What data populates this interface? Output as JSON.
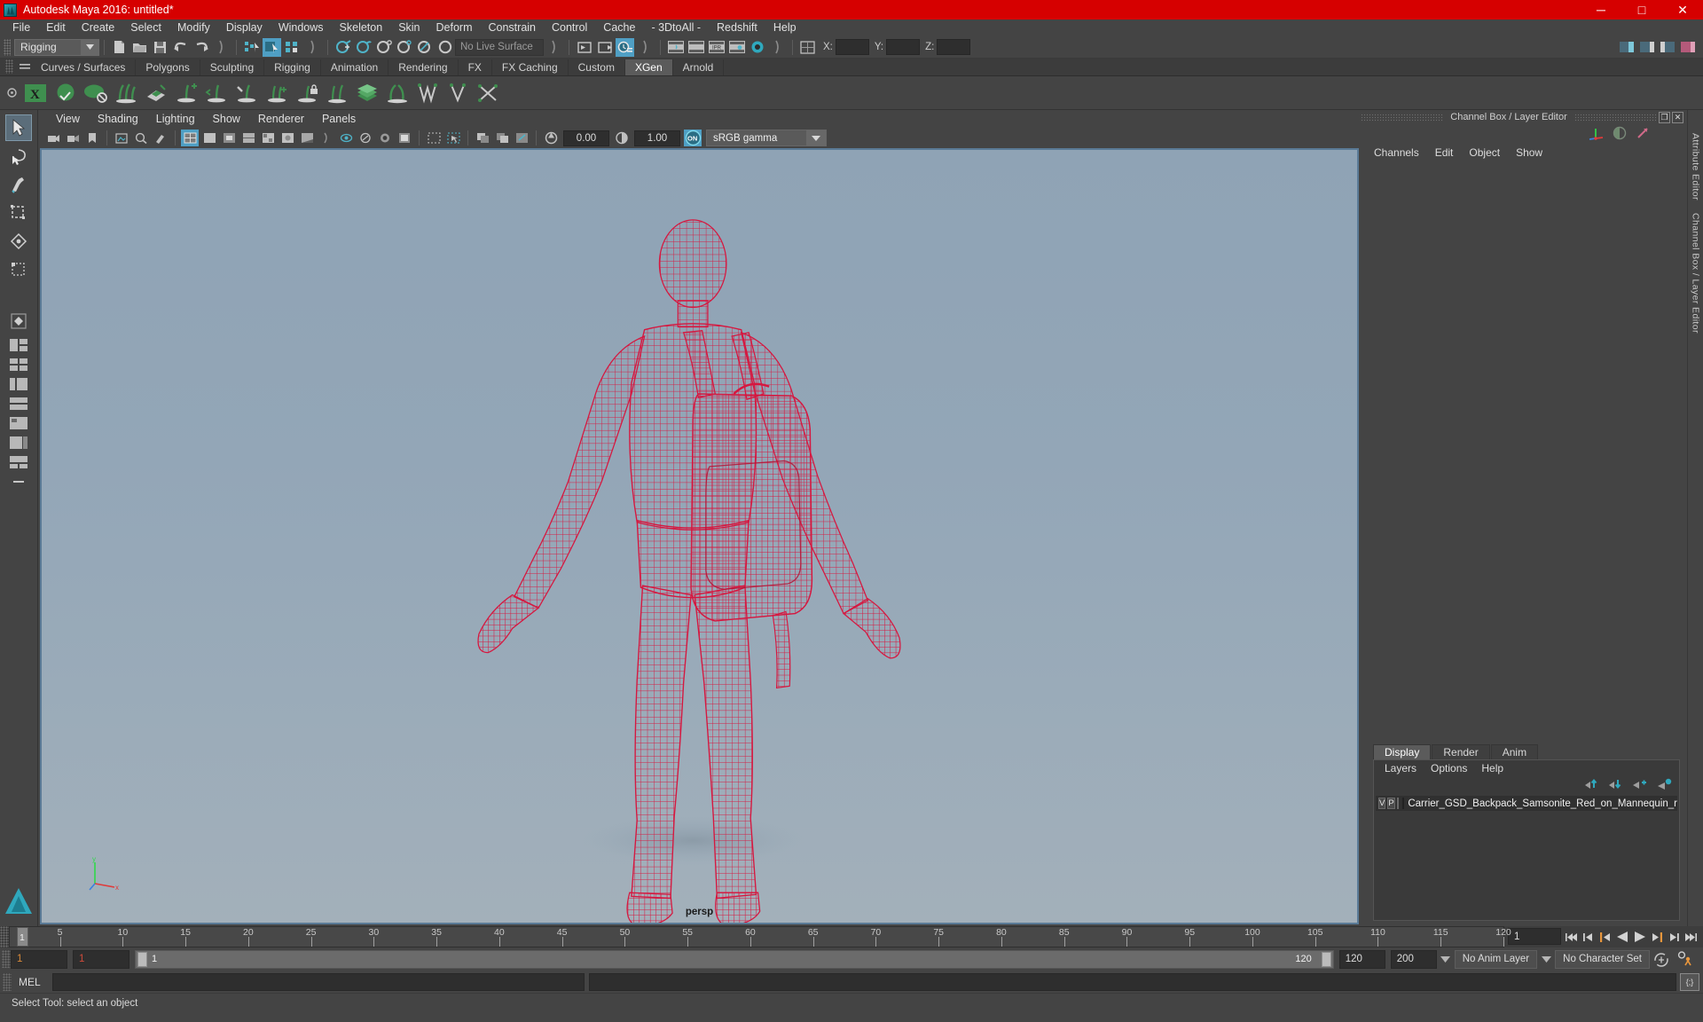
{
  "window": {
    "title": "Autodesk Maya 2016: untitled*",
    "minimize": "─",
    "maximize": "□",
    "close": "✕"
  },
  "menubar": {
    "items": [
      "File",
      "Edit",
      "Create",
      "Select",
      "Modify",
      "Display",
      "Windows",
      "Skeleton",
      "Skin",
      "Deform",
      "Constrain",
      "Control",
      "Cache",
      "- 3DtoAll -",
      "Redshift",
      "Help"
    ]
  },
  "statusline": {
    "mode": "Rigging",
    "live_surface": "No Live Surface",
    "coord_x_label": "X:",
    "coord_y_label": "Y:",
    "coord_z_label": "Z:",
    "coord_x": "",
    "coord_y": "",
    "coord_z": ""
  },
  "shelf": {
    "tabs": [
      "Curves / Surfaces",
      "Polygons",
      "Sculpting",
      "Rigging",
      "Animation",
      "Rendering",
      "FX",
      "FX Caching",
      "Custom",
      "XGen",
      "Arnold"
    ],
    "selected_tab": "XGen"
  },
  "viewport": {
    "menus": [
      "View",
      "Shading",
      "Lighting",
      "Show",
      "Renderer",
      "Panels"
    ],
    "exposure": "0.00",
    "gamma_value": "1.00",
    "color_management": "sRGB gamma",
    "cm_toggle": "ON",
    "camera_label": "persp",
    "axis_x": "x",
    "axis_y": "y",
    "axis_z": "z",
    "model_color": "#d6173f"
  },
  "channelbox": {
    "dock_title": "Channel Box / Layer Editor",
    "menus": [
      "Channels",
      "Edit",
      "Object",
      "Show"
    ]
  },
  "layer_editor": {
    "tabs": [
      "Display",
      "Render",
      "Anim"
    ],
    "selected_tab": "Display",
    "menus": [
      "Layers",
      "Options",
      "Help"
    ],
    "layers": [
      {
        "visibility": "V",
        "playback": "P",
        "reference": "",
        "color": "#b3173f",
        "name": "Carrier_GSD_Backpack_Samsonite_Red_on_Mannequin_r"
      }
    ]
  },
  "right_strip": {
    "labels": [
      "Attribute Editor",
      "Channel Box / Layer Editor"
    ]
  },
  "timeline": {
    "ticks": [
      5,
      10,
      15,
      20,
      25,
      30,
      35,
      40,
      45,
      50,
      55,
      60,
      65,
      70,
      75,
      80,
      85,
      90,
      95,
      100,
      105,
      110,
      115,
      120
    ],
    "start": 1,
    "end": 120,
    "current_frame": "1",
    "current_frame_field": "1",
    "playback_buttons": [
      "go-to-start",
      "step-back-key",
      "step-back-frame",
      "play-backwards",
      "play-forwards",
      "step-forward-frame",
      "step-forward-key",
      "go-to-end"
    ]
  },
  "range": {
    "anim_start": "1",
    "range_start": "1",
    "slider_left_label": "1",
    "slider_right_label": "120",
    "range_end": "120",
    "anim_end": "200",
    "anim_layer": "No Anim Layer",
    "character_set": "No Character Set"
  },
  "commandline": {
    "label": "MEL",
    "input": "",
    "output": ""
  },
  "helpline": {
    "text": "Select Tool: select an object"
  }
}
